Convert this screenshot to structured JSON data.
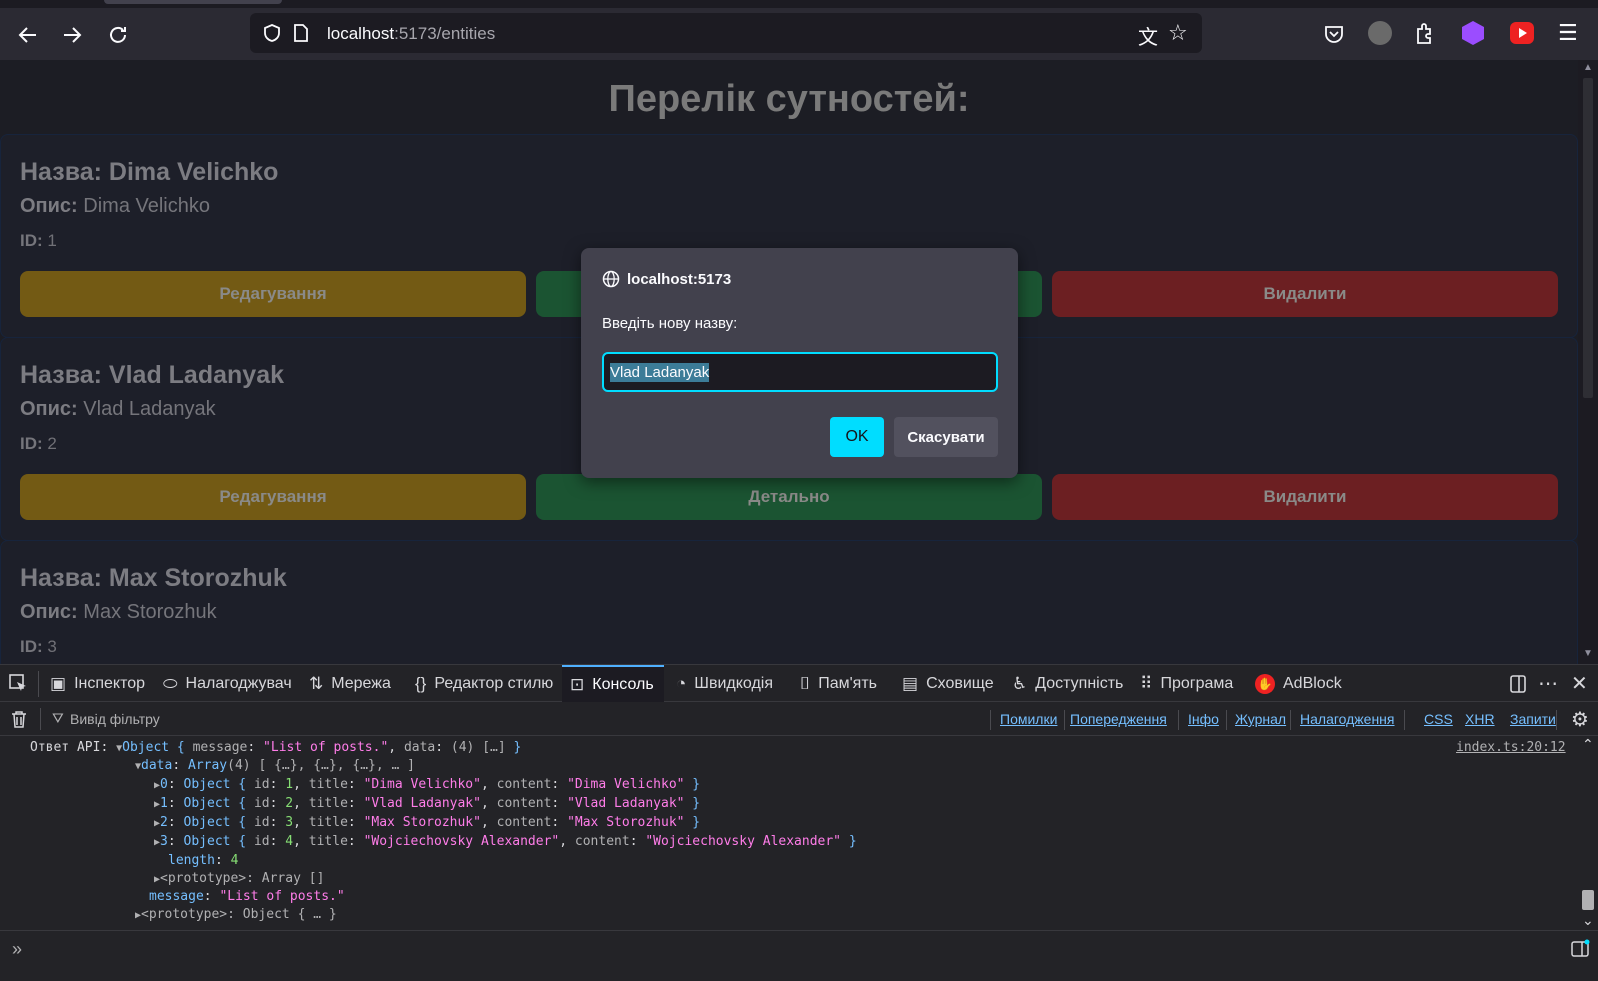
{
  "browser": {
    "url_host": "localhost",
    "url_path": ":5173/entities"
  },
  "page": {
    "title": "Перелік сутностей:",
    "name_label": "Назва:",
    "desc_label": "Опис:",
    "id_label": "ID:",
    "entities": [
      {
        "name": "Dima Velichko",
        "desc": "Dima Velichko",
        "id": "1"
      },
      {
        "name": "Vlad Ladanyak",
        "desc": "Vlad Ladanyak",
        "id": "2"
      },
      {
        "name": "Max Storozhuk",
        "desc": "Max Storozhuk",
        "id": "3"
      }
    ],
    "edit_label": "Редагування",
    "detail_label": "Детально",
    "delete_label": "Видалити"
  },
  "dialog": {
    "origin": "localhost:5173",
    "message": "Введіть нову назву:",
    "input_value": "Vlad Ladanyak",
    "ok_label": "OK",
    "cancel_label": "Скасувати"
  },
  "devtools": {
    "tabs": [
      "Інспектор",
      "Налагоджувач",
      "Мережа",
      "Редактор стилю",
      "Консоль",
      "Швидкодія",
      "Пам'ять",
      "Сховище",
      "Доступність",
      "Програма",
      "AdBlock"
    ],
    "filter_placeholder": "Вивід фільтру",
    "filters": [
      "Помилки",
      "Попередження",
      "Інфо",
      "Журнал",
      "Налагодження",
      "CSS",
      "XHR",
      "Запити"
    ],
    "log_source": "index.ts:20:12",
    "log_prefix": "Ответ API:"
  },
  "colors": {
    "accent": "#00ddff",
    "edit": "#735a14",
    "detail": "#1b5432",
    "delete": "#6c1f22"
  }
}
